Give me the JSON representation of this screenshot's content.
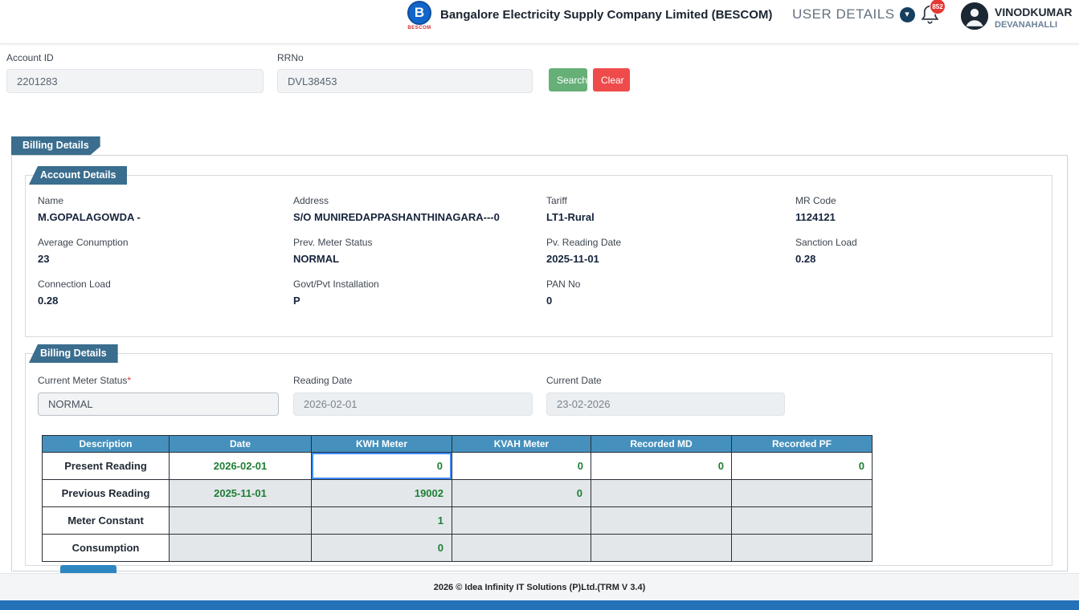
{
  "colors": {
    "tab_blue": "#3a6d8e",
    "table_header_blue": "#4590bd",
    "search_green": "#66b078",
    "clear_red": "#ef4b4b",
    "value_green": "#1e7e34",
    "bottom_bar_blue": "#2471b8",
    "badge_red": "#e53935"
  },
  "header": {
    "title": "Bangalore Electricity Supply Company Limited (BESCOM)",
    "logo_letter": "B",
    "logo_text": "BESCOM",
    "user_details_label": "USER DETAILS",
    "chevron": "▾",
    "notification_count": "852",
    "username": "VINODKUMAR",
    "location": "DEVANAHALLI"
  },
  "search": {
    "account_id_label": "Account ID",
    "account_id_value": "2201283",
    "rrno_label": "RRNo",
    "rrno_value": "DVL38453",
    "search_button": "Search",
    "clear_button": "Clear"
  },
  "billing": {
    "section_tab": "Billing Details",
    "account_details": {
      "tab": "Account Details",
      "fields": [
        {
          "label": "Name",
          "value": "M.GOPALAGOWDA -"
        },
        {
          "label": "Address",
          "value": "S/O MUNIREDAPPASHANTHINAGARA---0"
        },
        {
          "label": "Tariff",
          "value": "LT1-Rural"
        },
        {
          "label": "MR Code",
          "value": "1124121"
        },
        {
          "label": "Average Conumption",
          "value": "23"
        },
        {
          "label": "Prev. Meter Status",
          "value": "NORMAL"
        },
        {
          "label": "Pv. Reading Date",
          "value": "2025-11-01"
        },
        {
          "label": "Sanction Load",
          "value": "0.28"
        },
        {
          "label": "Connection Load",
          "value": "0.28"
        },
        {
          "label": "Govt/Pvt Installation",
          "value": "P"
        },
        {
          "label": "PAN No",
          "value": "0"
        }
      ]
    },
    "billing_details": {
      "tab": "Billing Details",
      "current_meter_status_label": "Current Meter Status",
      "required_mark": "*",
      "current_meter_status_value": "NORMAL",
      "reading_date_label": "Reading Date",
      "reading_date_value": "2026-02-01",
      "current_date_label": "Current Date",
      "current_date_value": "23-02-2026"
    },
    "table": {
      "headers": [
        "Description",
        "Date",
        "KWH Meter",
        "KVAH Meter",
        "Recorded MD",
        "Recorded PF"
      ],
      "rows": [
        {
          "description": "Present Reading",
          "date": "2026-02-01",
          "kwh": "0",
          "kvah": "0",
          "md": "0",
          "pf": "0"
        },
        {
          "description": "Previous Reading",
          "date": "2025-11-01",
          "kwh": "19002",
          "kvah": "0",
          "md": "",
          "pf": ""
        },
        {
          "description": "Meter Constant",
          "date": "",
          "kwh": "1",
          "kvah": "",
          "md": "",
          "pf": ""
        },
        {
          "description": "Consumption",
          "date": "",
          "kwh": "0",
          "kvah": "",
          "md": "",
          "pf": ""
        }
      ]
    }
  },
  "footer": {
    "text": "2026 © Idea Infinity IT Solutions (P)Ltd.(TRM V 3.4)"
  }
}
